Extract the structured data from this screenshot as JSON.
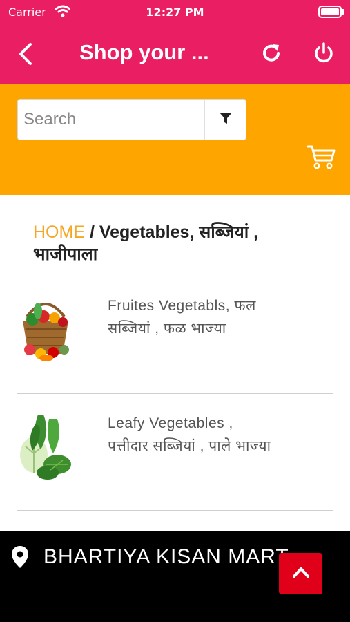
{
  "status_bar": {
    "carrier": "Carrier",
    "time": "12:27 PM"
  },
  "nav": {
    "title": "Shop your ..."
  },
  "search": {
    "placeholder": "Search"
  },
  "breadcrumb": {
    "home": "HOME",
    "rest": " / Vegetables, सब्जियां , भाजीपाला"
  },
  "categories": [
    {
      "label": "Fruites Vegetabls, फल सब्जियां , फळ भाज्या",
      "image": "fruit-vegetable-basket"
    },
    {
      "label": "Leafy Vegetables , पत्तीदार सब्जियां , पाले भाज्या",
      "image": "leafy-vegetables"
    }
  ],
  "footer": {
    "store_name": "BHARTIYA KISAN MART"
  },
  "colors": {
    "nav": "#E91E63",
    "search_band": "#FFA500",
    "home_link": "#F5A623",
    "footer": "#000000",
    "scroll_button": "#E0001A"
  }
}
